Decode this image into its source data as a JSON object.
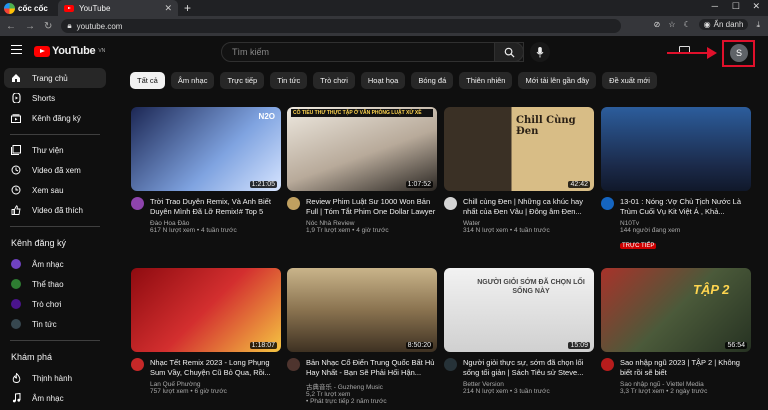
{
  "browser": {
    "brand": "cốc cốc",
    "tab_title": "YouTube",
    "url": "youtube.com",
    "profile_label": "Ẩn danh"
  },
  "header": {
    "logo_text": "YouTube",
    "country": "VN",
    "search_placeholder": "Tìm kiếm",
    "avatar_letter": "S"
  },
  "sidebar": {
    "main": [
      {
        "label": "Trang chủ",
        "icon": "home-icon"
      },
      {
        "label": "Shorts",
        "icon": "shorts-icon"
      },
      {
        "label": "Kênh đăng ký",
        "icon": "subscriptions-icon"
      }
    ],
    "library": [
      {
        "label": "Thư viện",
        "icon": "library-icon"
      },
      {
        "label": "Video đã xem",
        "icon": "history-icon"
      },
      {
        "label": "Xem sau",
        "icon": "clock-icon"
      },
      {
        "label": "Video đã thích",
        "icon": "like-icon"
      }
    ],
    "subs_heading": "Kênh đăng ký",
    "subs": [
      {
        "label": "Âm nhạc",
        "icon": "music-icon",
        "color": "#6f42c1"
      },
      {
        "label": "Thể thao",
        "icon": "trophy-icon",
        "color": "#2e7d32"
      },
      {
        "label": "Trò chơi",
        "icon": "gamepad-icon",
        "color": "#4a148c"
      },
      {
        "label": "Tin tức",
        "icon": "news-icon",
        "color": "#37474f"
      }
    ],
    "explore_heading": "Khám phá",
    "explore": [
      {
        "label": "Thịnh hành",
        "icon": "fire-icon"
      },
      {
        "label": "Âm nhạc",
        "icon": "music-note-icon"
      }
    ]
  },
  "chips": [
    "Tất cả",
    "Âm nhạc",
    "Trực tiếp",
    "Tin tức",
    "Trò chơi",
    "Hoạt họa",
    "Bóng đá",
    "Thiên nhiên",
    "Mới tải lên gần đây",
    "Đề xuất mới"
  ],
  "videos": [
    {
      "title": "Trời Trao Duyên Remix, Và Anh Biết Duyên Mình Đã Lỡ Remix!# Top 5 Nhạc...",
      "channel": "Đào Hoa Đảo",
      "stats": "617 N lượt xem • 4 tuần trước",
      "duration": "1:21:05",
      "thumb": "#2b3a6b",
      "thumb2": "#7fa3e0",
      "avatar": "#8e44ad",
      "badge": "N2O",
      "thumb_title": ""
    },
    {
      "title": "Review Phim Luật Sư 1000 Won Bản Full | Tóm Tắt Phim One Dollar Lawyer",
      "channel": "Nóc Nhà Review",
      "stats": "1,9 Tr lượt xem • 4 giờ trước",
      "duration": "1:07:52",
      "thumb": "#d8d2c8",
      "thumb2": "#8a7f74",
      "avatar": "#c0a060",
      "badge": "",
      "thumb_title": "CÔ TIỂU THƯ THỰC TẬP Ở VĂN PHÒNG LUẬT XỬ XỀ"
    },
    {
      "title": "Chill cùng Đen | Những ca khúc hay nhất của Đen Vâu | Đông âm Đen...",
      "channel": "Water",
      "stats": "314 N lượt xem • 4 tuần trước",
      "duration": "42:42",
      "thumb": "#c9a86a",
      "thumb2": "#6b5630",
      "avatar": "#d4d4d4",
      "badge": "",
      "thumb_title": "Chill Cùng Đen"
    },
    {
      "title": "13-01 : Nóng :Vợ Chủ Tịch Nước Là Trùm Cuối Vụ Kit Việt Á , Khả...",
      "channel": "N10Tv",
      "stats": "144 người đang xem",
      "duration": "",
      "thumb": "#1b2a4a",
      "thumb2": "#3d6aa8",
      "avatar": "#1565c0",
      "badge": "",
      "thumb_title": "",
      "live": "TRỰC TIẾP"
    },
    {
      "title": "Nhạc Tết Remix 2023 - Long Phụng Sum Vầy, Chuyện Cũ Bỏ Qua, Rồi...",
      "channel": "Lan Quế Phường",
      "stats": "757 lượt xem • 6 giờ trước",
      "duration": "1:18:07",
      "thumb": "#b3121b",
      "thumb2": "#f5c542",
      "avatar": "#c62828",
      "badge": "",
      "thumb_title": ""
    },
    {
      "title": "Bản Nhạc Cổ Điển Trung Quốc Bất Hủ Hay Nhất - Bạn Sẽ Phải Hối Hận...",
      "channel": "古典音乐 - Guzheng Music",
      "stats": "5,2 Tr lượt xem",
      "duration": "8:50:20",
      "thumb": "#6b5a45",
      "thumb2": "#c9b48a",
      "avatar": "#4e342e",
      "badge": "",
      "thumb_title": "",
      "extra": "• Phát trực tiếp 2 năm trước"
    },
    {
      "title": "Người giỏi thực sự, sớm đã chọn lối sống tối giản | Sách Tiêu sử Steve...",
      "channel": "Better Version",
      "stats": "214 N lượt xem • 3 tuần trước",
      "duration": "15:09",
      "thumb": "#e8e8e8",
      "thumb2": "#9e9e9e",
      "avatar": "#263238",
      "badge": "",
      "thumb_title": "NGƯỜI GIỎI SỚM ĐÃ CHỌN LỐI SỐNG NÀY"
    },
    {
      "title": "Sao nhập ngũ 2023 | TẬP 2 | Không biết rồi sẽ biết",
      "channel": "Sao nhập ngũ - Viettel Media",
      "stats": "3,3 Tr lượt xem • 2 ngày trước",
      "duration": "56:54",
      "thumb": "#2f4a2a",
      "thumb2": "#a8322a",
      "avatar": "#b71c1c",
      "badge": "",
      "thumb_title": "TẬP 2"
    }
  ]
}
